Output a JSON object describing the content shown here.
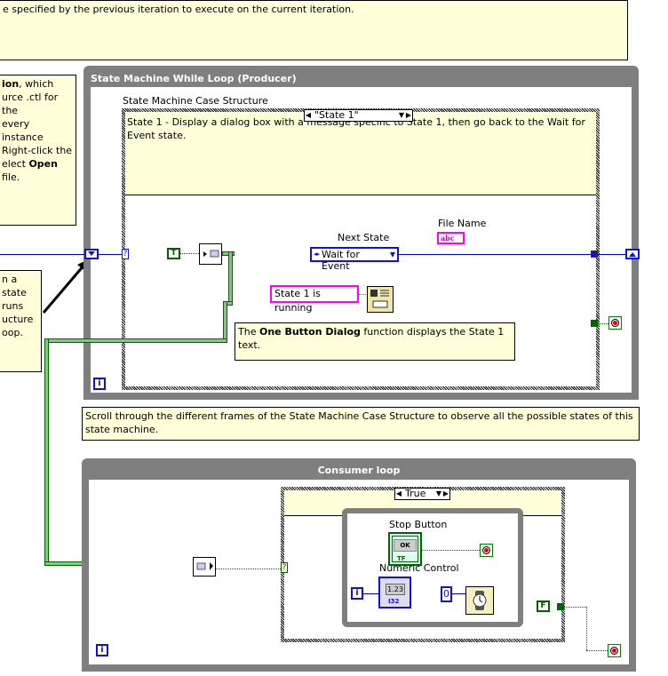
{
  "comments": {
    "top": "e specified by the previous iteration to execute on the current iteration.",
    "left_upper": {
      "lines": [
        {
          "bold": "ion",
          "text": ", which"
        },
        {
          "bold": "",
          "text": "urce .ctl for the"
        },
        {
          "bold": "",
          "text": "every instance"
        },
        {
          "bold": "",
          "text": " Right-click the"
        },
        {
          "prefix": "elect ",
          "bold": "Open",
          "text": ""
        },
        {
          "bold": "",
          "text": " file."
        }
      ]
    },
    "left_lower": [
      "n a state",
      "runs",
      "ucture",
      "oop."
    ],
    "state1_description": "State 1 - Display a dialog box with a message specific to State 1, then go back to the Wait for Event state.",
    "one_button": {
      "prefix": "The ",
      "bold": "One Button Dialog",
      "suffix": " function displays the State 1 text."
    },
    "scroll": "Scroll through the different frames of the State Machine Case Structure to observe all the possible states of this state machine."
  },
  "producer_loop": {
    "title": "State Machine While Loop (Producer)",
    "case_label": "State Machine Case Structure",
    "case_selector": "\"State 1\"",
    "next_state_label": "Next State",
    "next_state_value": "Wait for Event",
    "file_name_label": "File Name",
    "file_name_glyph": "abc",
    "message_constant": "State 1 is running",
    "true_constant": "T",
    "iteration_glyph": "i"
  },
  "consumer_loop": {
    "title": "Consumer loop",
    "case_selector": "True",
    "stop_button_label": "Stop Button",
    "stop_button_glyph": "OK",
    "stop_button_type": "TF",
    "numeric_control_label": "Numeric Control",
    "numeric_glyph": "1.23",
    "numeric_type": "I32",
    "wait_constant": "0",
    "false_constant": "F",
    "iteration_glyph": "i",
    "inner_iteration_glyph": "i"
  },
  "colors": {
    "comment_bg": "#ffffd9",
    "loop_gray": "#7f7f7f",
    "enum_blue": "#1010e0",
    "string_pink": "#ff00ff",
    "bool_green": "#006400"
  }
}
